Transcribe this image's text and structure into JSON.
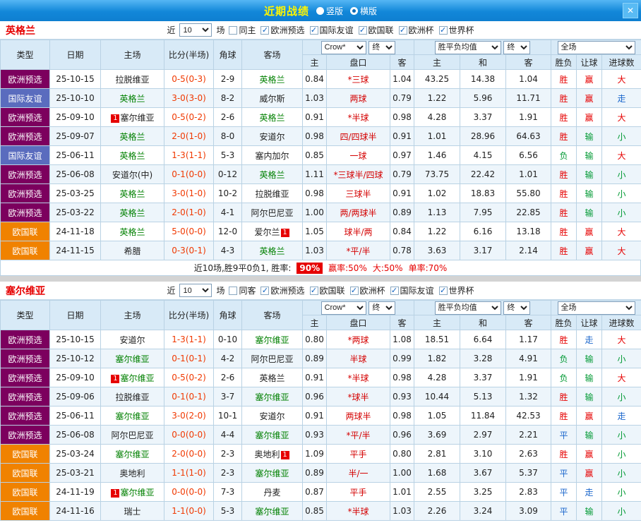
{
  "titlebar": {
    "title": "近期战绩",
    "radio_vertical": "竖版",
    "radio_horizontal": "横版",
    "close": "✕"
  },
  "colors": {
    "focus_team": "#008000",
    "win_red": "#e60000",
    "lose_green": "#009933",
    "push_blue": "#1a66cc",
    "type_euro_qualifier": "#7c005e",
    "type_friendly": "#5a6cbe",
    "type_nations_league": "#f08200",
    "header_bg": "#d8eaf7"
  },
  "headers": {
    "type": "类型",
    "date": "日期",
    "home": "主场",
    "score": "比分(半场)",
    "corner": "角球",
    "away": "客场",
    "h_home": "主",
    "h_line": "盘口",
    "h_away": "客",
    "o_home": "主",
    "o_draw": "和",
    "o_away": "客",
    "r_result": "胜负",
    "r_handicap": "让球",
    "r_goals": "进球数",
    "crow": "Crow*",
    "final": "终",
    "wdl": "胜平负均值",
    "scope": "全场"
  },
  "sections": [
    {
      "team": "英格兰",
      "filter": {
        "near_label": "近",
        "near_value": "10",
        "games_label": "场",
        "checkboxes": [
          {
            "label": "同主",
            "checked": false
          },
          {
            "label": "欧洲预选",
            "checked": true
          },
          {
            "label": "国际友谊",
            "checked": true
          },
          {
            "label": "欧国联",
            "checked": true
          },
          {
            "label": "欧洲杯",
            "checked": true
          },
          {
            "label": "世界杯",
            "checked": true
          }
        ]
      },
      "rows": [
        {
          "type": "欧洲预选",
          "tc": "purple",
          "date": "25-10-15",
          "home": "拉脱维亚",
          "hf": false,
          "score": "0-5(0-3)",
          "corner": "2-9",
          "away": "英格兰",
          "af": true,
          "o1": "0.84",
          "hc": "*三球",
          "o2": "1.04",
          "w": "43.25",
          "d": "14.38",
          "l": "1.04",
          "r1": "胜",
          "c1": "red",
          "r2": "赢",
          "c2": "red",
          "r3": "大",
          "c3": "red"
        },
        {
          "type": "国际友谊",
          "tc": "blue",
          "date": "25-10-10",
          "home": "英格兰",
          "hf": true,
          "score": "3-0(3-0)",
          "corner": "8-2",
          "away": "威尔斯",
          "af": false,
          "o1": "1.03",
          "hc": "两球",
          "o2": "0.79",
          "w": "1.22",
          "d": "5.96",
          "l": "11.71",
          "r1": "胜",
          "c1": "red",
          "r2": "赢",
          "c2": "red",
          "r3": "走",
          "c3": "blue"
        },
        {
          "type": "欧洲预选",
          "tc": "purple",
          "date": "25-09-10",
          "home": "塞尔维亚",
          "hf": false,
          "hb": "1",
          "score": "0-5(0-2)",
          "corner": "2-6",
          "away": "英格兰",
          "af": true,
          "o1": "0.91",
          "hc": "*半球",
          "o2": "0.98",
          "w": "4.28",
          "d": "3.37",
          "l": "1.91",
          "r1": "胜",
          "c1": "red",
          "r2": "赢",
          "c2": "red",
          "r3": "大",
          "c3": "red"
        },
        {
          "type": "欧洲预选",
          "tc": "purple",
          "date": "25-09-07",
          "home": "英格兰",
          "hf": true,
          "score": "2-0(1-0)",
          "corner": "8-0",
          "away": "安道尔",
          "af": false,
          "o1": "0.98",
          "hc": "四/四球半",
          "o2": "0.91",
          "w": "1.01",
          "d": "28.96",
          "l": "64.63",
          "r1": "胜",
          "c1": "red",
          "r2": "输",
          "c2": "green",
          "r3": "小",
          "c3": "green"
        },
        {
          "type": "国际友谊",
          "tc": "blue",
          "date": "25-06-11",
          "home": "英格兰",
          "hf": true,
          "score": "1-3(1-1)",
          "corner": "5-3",
          "away": "塞内加尔",
          "af": false,
          "o1": "0.85",
          "hc": "一球",
          "o2": "0.97",
          "w": "1.46",
          "d": "4.15",
          "l": "6.56",
          "r1": "负",
          "c1": "green",
          "r2": "输",
          "c2": "green",
          "r3": "大",
          "c3": "red"
        },
        {
          "type": "欧洲预选",
          "tc": "purple",
          "date": "25-06-08",
          "home": "安道尔(中)",
          "hf": false,
          "score": "0-1(0-0)",
          "corner": "0-12",
          "away": "英格兰",
          "af": true,
          "o1": "1.11",
          "hc": "*三球半/四球",
          "o2": "0.79",
          "w": "73.75",
          "d": "22.42",
          "l": "1.01",
          "r1": "胜",
          "c1": "red",
          "r2": "输",
          "c2": "green",
          "r3": "小",
          "c3": "green"
        },
        {
          "type": "欧洲预选",
          "tc": "purple",
          "date": "25-03-25",
          "home": "英格兰",
          "hf": true,
          "score": "3-0(1-0)",
          "corner": "10-2",
          "away": "拉脱维亚",
          "af": false,
          "o1": "0.98",
          "hc": "三球半",
          "o2": "0.91",
          "w": "1.02",
          "d": "18.83",
          "l": "55.80",
          "r1": "胜",
          "c1": "red",
          "r2": "输",
          "c2": "green",
          "r3": "小",
          "c3": "green"
        },
        {
          "type": "欧洲预选",
          "tc": "purple",
          "date": "25-03-22",
          "home": "英格兰",
          "hf": true,
          "score": "2-0(1-0)",
          "corner": "4-1",
          "away": "阿尔巴尼亚",
          "af": false,
          "o1": "1.00",
          "hc": "两/两球半",
          "o2": "0.89",
          "w": "1.13",
          "d": "7.95",
          "l": "22.85",
          "r1": "胜",
          "c1": "red",
          "r2": "输",
          "c2": "green",
          "r3": "小",
          "c3": "green"
        },
        {
          "type": "欧国联",
          "tc": "orange",
          "date": "24-11-18",
          "home": "英格兰",
          "hf": true,
          "score": "5-0(0-0)",
          "corner": "12-0",
          "away": "爱尔兰",
          "af": false,
          "ab": "1",
          "o1": "1.05",
          "hc": "球半/两",
          "o2": "0.84",
          "w": "1.22",
          "d": "6.16",
          "l": "13.18",
          "r1": "胜",
          "c1": "red",
          "r2": "赢",
          "c2": "red",
          "r3": "大",
          "c3": "red"
        },
        {
          "type": "欧国联",
          "tc": "orange",
          "date": "24-11-15",
          "home": "希腊",
          "hf": false,
          "score": "0-3(0-1)",
          "corner": "4-3",
          "away": "英格兰",
          "af": true,
          "o1": "1.03",
          "hc": "*平/半",
          "o2": "0.78",
          "w": "3.63",
          "d": "3.17",
          "l": "2.14",
          "r1": "胜",
          "c1": "red",
          "r2": "赢",
          "c2": "red",
          "r3": "大",
          "c3": "red"
        }
      ],
      "summary": {
        "prefix": "近10场,胜9平0负1, 胜率:",
        "rate": "90%",
        "stat1": "赢率:50%",
        "stat2": "大:50%",
        "stat3": "单率:70%"
      }
    },
    {
      "team": "塞尔维亚",
      "filter": {
        "near_label": "近",
        "near_value": "10",
        "games_label": "场",
        "checkboxes": [
          {
            "label": "同客",
            "checked": false
          },
          {
            "label": "欧洲预选",
            "checked": true
          },
          {
            "label": "欧国联",
            "checked": true
          },
          {
            "label": "欧洲杯",
            "checked": true
          },
          {
            "label": "国际友谊",
            "checked": true
          },
          {
            "label": "世界杯",
            "checked": true
          }
        ]
      },
      "rows": [
        {
          "type": "欧洲预选",
          "tc": "purple",
          "date": "25-10-15",
          "home": "安道尔",
          "hf": false,
          "score": "1-3(1-1)",
          "corner": "0-10",
          "away": "塞尔维亚",
          "af": true,
          "o1": "0.80",
          "hc": "*两球",
          "o2": "1.08",
          "w": "18.51",
          "d": "6.64",
          "l": "1.17",
          "r1": "胜",
          "c1": "red",
          "r2": "走",
          "c2": "blue",
          "r3": "大",
          "c3": "red"
        },
        {
          "type": "欧洲预选",
          "tc": "purple",
          "date": "25-10-12",
          "home": "塞尔维亚",
          "hf": true,
          "score": "0-1(0-1)",
          "corner": "4-2",
          "away": "阿尔巴尼亚",
          "af": false,
          "o1": "0.89",
          "hc": "半球",
          "o2": "0.99",
          "w": "1.82",
          "d": "3.28",
          "l": "4.91",
          "r1": "负",
          "c1": "green",
          "r2": "输",
          "c2": "green",
          "r3": "小",
          "c3": "green"
        },
        {
          "type": "欧洲预选",
          "tc": "purple",
          "date": "25-09-10",
          "home": "塞尔维亚",
          "hf": true,
          "hb": "1",
          "score": "0-5(0-2)",
          "corner": "2-6",
          "away": "英格兰",
          "af": false,
          "o1": "0.91",
          "hc": "*半球",
          "o2": "0.98",
          "w": "4.28",
          "d": "3.37",
          "l": "1.91",
          "r1": "负",
          "c1": "green",
          "r2": "输",
          "c2": "green",
          "r3": "大",
          "c3": "red"
        },
        {
          "type": "欧洲预选",
          "tc": "purple",
          "date": "25-09-06",
          "home": "拉脱维亚",
          "hf": false,
          "score": "0-1(0-1)",
          "corner": "3-7",
          "away": "塞尔维亚",
          "af": true,
          "o1": "0.96",
          "hc": "*球半",
          "o2": "0.93",
          "w": "10.44",
          "d": "5.13",
          "l": "1.32",
          "r1": "胜",
          "c1": "red",
          "r2": "输",
          "c2": "green",
          "r3": "小",
          "c3": "green"
        },
        {
          "type": "欧洲预选",
          "tc": "purple",
          "date": "25-06-11",
          "home": "塞尔维亚",
          "hf": true,
          "score": "3-0(2-0)",
          "corner": "10-1",
          "away": "安道尔",
          "af": false,
          "o1": "0.91",
          "hc": "两球半",
          "o2": "0.98",
          "w": "1.05",
          "d": "11.84",
          "l": "42.53",
          "r1": "胜",
          "c1": "red",
          "r2": "赢",
          "c2": "red",
          "r3": "走",
          "c3": "blue"
        },
        {
          "type": "欧洲预选",
          "tc": "purple",
          "date": "25-06-08",
          "home": "阿尔巴尼亚",
          "hf": false,
          "score": "0-0(0-0)",
          "corner": "4-4",
          "away": "塞尔维亚",
          "af": true,
          "o1": "0.93",
          "hc": "*平/半",
          "o2": "0.96",
          "w": "3.69",
          "d": "2.97",
          "l": "2.21",
          "r1": "平",
          "c1": "blue",
          "r2": "输",
          "c2": "green",
          "r3": "小",
          "c3": "green"
        },
        {
          "type": "欧国联",
          "tc": "orange",
          "date": "25-03-24",
          "home": "塞尔维亚",
          "hf": true,
          "score": "2-0(0-0)",
          "corner": "2-3",
          "away": "奥地利",
          "af": false,
          "ab": "1",
          "o1": "1.09",
          "hc": "平手",
          "o2": "0.80",
          "w": "2.81",
          "d": "3.10",
          "l": "2.63",
          "r1": "胜",
          "c1": "red",
          "r2": "赢",
          "c2": "red",
          "r3": "小",
          "c3": "green"
        },
        {
          "type": "欧国联",
          "tc": "orange",
          "date": "25-03-21",
          "home": "奥地利",
          "hf": false,
          "score": "1-1(1-0)",
          "corner": "2-3",
          "away": "塞尔维亚",
          "af": true,
          "o1": "0.89",
          "hc": "半/一",
          "o2": "1.00",
          "w": "1.68",
          "d": "3.67",
          "l": "5.37",
          "r1": "平",
          "c1": "blue",
          "r2": "赢",
          "c2": "red",
          "r3": "小",
          "c3": "green"
        },
        {
          "type": "欧国联",
          "tc": "orange",
          "date": "24-11-19",
          "home": "塞尔维亚",
          "hf": true,
          "hb": "1",
          "score": "0-0(0-0)",
          "corner": "7-3",
          "away": "丹麦",
          "af": false,
          "o1": "0.87",
          "hc": "平手",
          "o2": "1.01",
          "w": "2.55",
          "d": "3.25",
          "l": "2.83",
          "r1": "平",
          "c1": "blue",
          "r2": "走",
          "c2": "blue",
          "r3": "小",
          "c3": "green"
        },
        {
          "type": "欧国联",
          "tc": "orange",
          "date": "24-11-16",
          "home": "瑞士",
          "hf": false,
          "score": "1-1(0-0)",
          "corner": "5-3",
          "away": "塞尔维亚",
          "af": true,
          "o1": "0.85",
          "hc": "*半球",
          "o2": "1.03",
          "w": "2.26",
          "d": "3.24",
          "l": "3.09",
          "r1": "平",
          "c1": "blue",
          "r2": "输",
          "c2": "green",
          "r3": "小",
          "c3": "green"
        }
      ]
    }
  ]
}
